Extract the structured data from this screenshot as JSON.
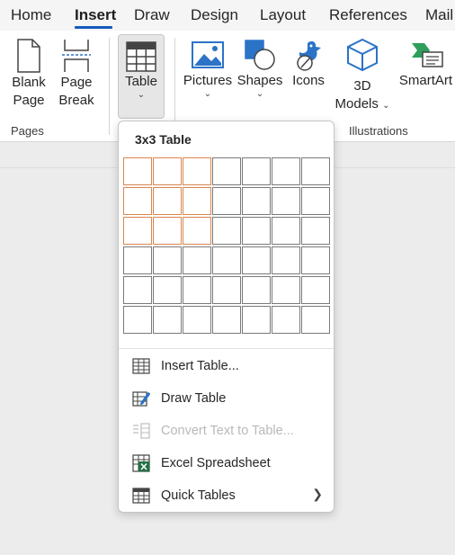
{
  "tabs": [
    {
      "label": "Home"
    },
    {
      "label": "Insert"
    },
    {
      "label": "Draw"
    },
    {
      "label": "Design"
    },
    {
      "label": "Layout"
    },
    {
      "label": "References"
    },
    {
      "label": "Mail"
    }
  ],
  "active_tab": "Insert",
  "ribbon": {
    "blank_page": {
      "line1": "Blank",
      "line2": "Page"
    },
    "page_break": {
      "line1": "Page",
      "line2": "Break"
    },
    "table": {
      "label": "Table"
    },
    "pictures": {
      "label": "Pictures"
    },
    "shapes": {
      "label": "Shapes"
    },
    "icons": {
      "label": "Icons"
    },
    "models_3d": {
      "line1": "3D",
      "line2": "Models"
    },
    "smartart": {
      "label": "SmartArt"
    },
    "groups": {
      "pages": "Pages",
      "illustrations": "Illustrations"
    }
  },
  "dropdown": {
    "title": "3x3 Table",
    "grid": {
      "columns": 7,
      "rows": 6,
      "selected_columns": 3,
      "selected_rows": 3
    },
    "items": [
      {
        "label": "Insert Table...",
        "enabled": true,
        "icon": "insert-table-icon"
      },
      {
        "label": "Draw Table",
        "enabled": true,
        "icon": "draw-table-icon"
      },
      {
        "label": "Convert Text to Table...",
        "enabled": false,
        "icon": "convert-text-icon"
      },
      {
        "label": "Excel Spreadsheet",
        "enabled": true,
        "icon": "excel-icon"
      },
      {
        "label": "Quick Tables",
        "enabled": true,
        "icon": "quick-tables-icon",
        "submenu": true
      }
    ]
  },
  "colors": {
    "accent": "#185abd",
    "grid_selected": "#d9874f",
    "grid_default": "#7a7a7a",
    "excel_green": "#1e7145",
    "smartart_green": "#2e9e5b"
  }
}
